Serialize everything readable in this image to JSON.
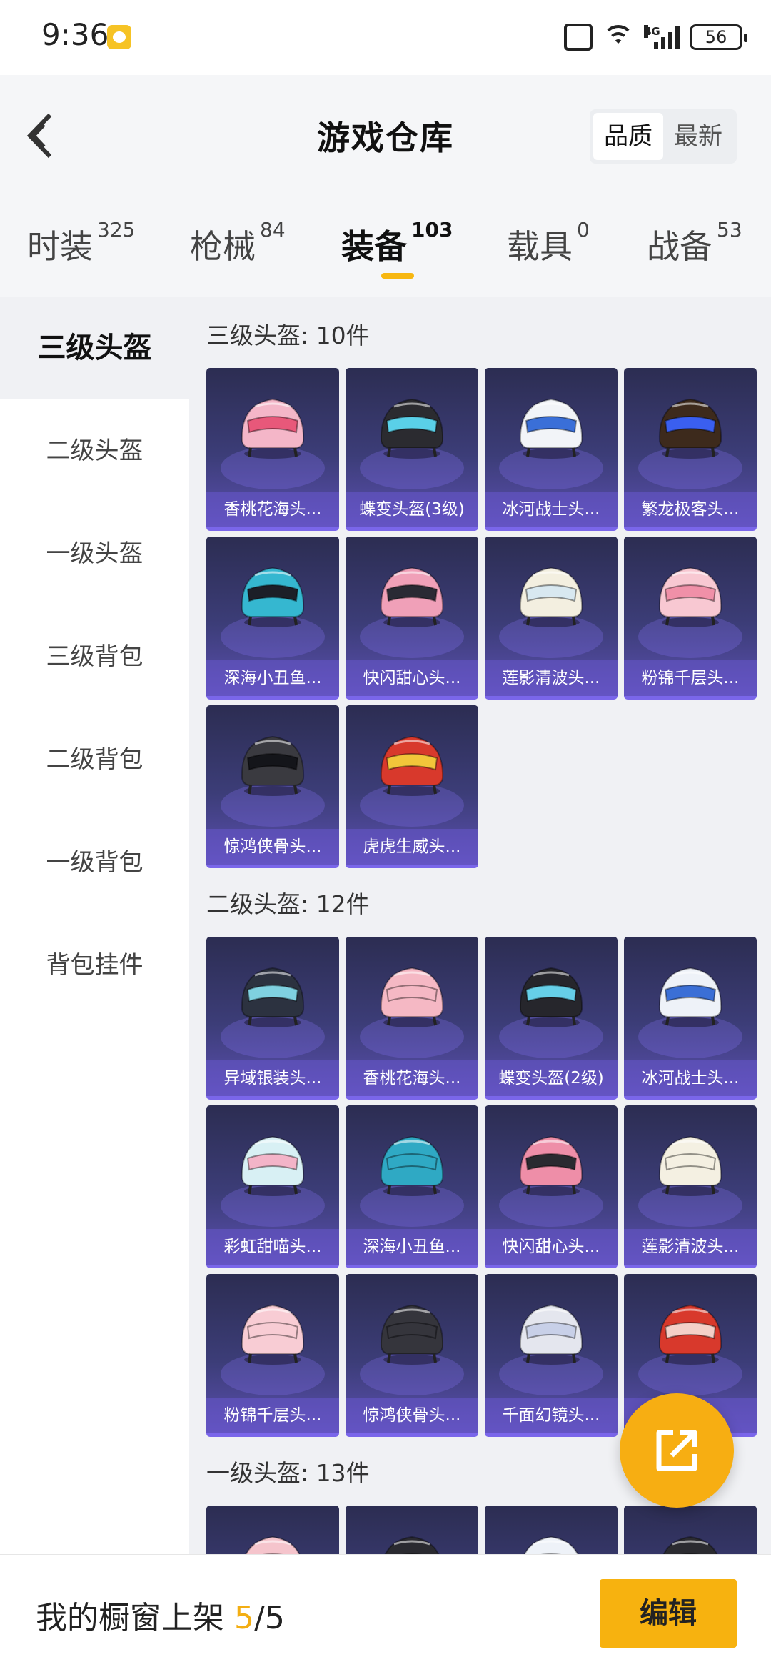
{
  "status_bar": {
    "time": "9:36",
    "battery": "56",
    "network": "4G"
  },
  "header": {
    "title": "游戏仓库",
    "sort_options": [
      "品质",
      "最新"
    ],
    "sort_selected": "品质"
  },
  "tabs": [
    {
      "label": "时装",
      "count": "325"
    },
    {
      "label": "枪械",
      "count": "84"
    },
    {
      "label": "装备",
      "count": "103",
      "active": true
    },
    {
      "label": "载具",
      "count": "0"
    },
    {
      "label": "战备",
      "count": "53"
    }
  ],
  "sidebar": {
    "items": [
      "三级头盔",
      "二级头盔",
      "一级头盔",
      "三级背包",
      "二级背包",
      "一级背包",
      "背包挂件"
    ],
    "active": "三级头盔"
  },
  "sections": [
    {
      "title": "三级头盔: 10件",
      "items": [
        {
          "label": "香桃花海头...",
          "color": "#f4b6c8",
          "visor": "#e8587a"
        },
        {
          "label": "蝶变头盔(3级)",
          "color": "#2b2b30",
          "visor": "#5ad0e8"
        },
        {
          "label": "冰河战士头...",
          "color": "#f2f4f8",
          "visor": "#3a6fd8"
        },
        {
          "label": "繁龙极客头...",
          "color": "#3d2a1c",
          "visor": "#3a5ff0"
        },
        {
          "label": "深海小丑鱼...",
          "color": "#35b7d0",
          "visor": "#1c1f28"
        },
        {
          "label": "快闪甜心头...",
          "color": "#f0a0b8",
          "visor": "#2a2a34"
        },
        {
          "label": "莲影清波头...",
          "color": "#f3efe0",
          "visor": "#d8e8f0"
        },
        {
          "label": "粉锦千层头...",
          "color": "#f8c8d2",
          "visor": "#f090a8"
        },
        {
          "label": "惊鸿侠骨头...",
          "color": "#3a3a40",
          "visor": "#14151a"
        },
        {
          "label": "虎虎生威头...",
          "color": "#d8392c",
          "visor": "#f2c63a"
        }
      ]
    },
    {
      "title": "二级头盔: 12件",
      "items": [
        {
          "label": "异域银装头...",
          "color": "#2c3240",
          "visor": "#7fd0e0"
        },
        {
          "label": "香桃花海头...",
          "color": "#f5b8c4",
          "visor": "#f5b8c4"
        },
        {
          "label": "蝶变头盔(2级)",
          "color": "#26262c",
          "visor": "#66cfe8"
        },
        {
          "label": "冰河战士头...",
          "color": "#eef2f8",
          "visor": "#3b6fd6"
        },
        {
          "label": "彩虹甜喵头...",
          "color": "#d8f0f4",
          "visor": "#f3b4c8"
        },
        {
          "label": "深海小丑鱼...",
          "color": "#2fa9c4",
          "visor": "#2fa9c4"
        },
        {
          "label": "快闪甜心头...",
          "color": "#ee8ea8",
          "visor": "#2a2a30"
        },
        {
          "label": "莲影清波头...",
          "color": "#f4f0e2",
          "visor": "#f4f0e2"
        },
        {
          "label": "粉锦千层头...",
          "color": "#f8ccd4",
          "visor": "#f8ccd4"
        },
        {
          "label": "惊鸿侠骨头...",
          "color": "#35353c",
          "visor": "#35353c"
        },
        {
          "label": "千面幻镜头...",
          "color": "#e4e6ee",
          "visor": "#c8d0e8"
        },
        {
          "label": "",
          "color": "#d8392c",
          "visor": "#f4d0c8"
        }
      ]
    },
    {
      "title": "一级头盔: 13件",
      "items": [
        {
          "label": "",
          "color": "#f5c4cc",
          "visor": "#f5c4cc"
        },
        {
          "label": "",
          "color": "#2a2a30",
          "visor": "#2a2a30"
        },
        {
          "label": "",
          "color": "#eef2f8",
          "visor": "#3b6fd6"
        },
        {
          "label": "",
          "color": "#2b2b30",
          "visor": "#2b2b30"
        }
      ]
    }
  ],
  "bottom_bar": {
    "text": "我的橱窗上架 ",
    "used": "5",
    "slash_total": "/5",
    "edit_label": "编辑"
  },
  "colors": {
    "accent": "#f7b20f",
    "card_bg": "#3c3d78",
    "card_border": "#7a66ea"
  }
}
